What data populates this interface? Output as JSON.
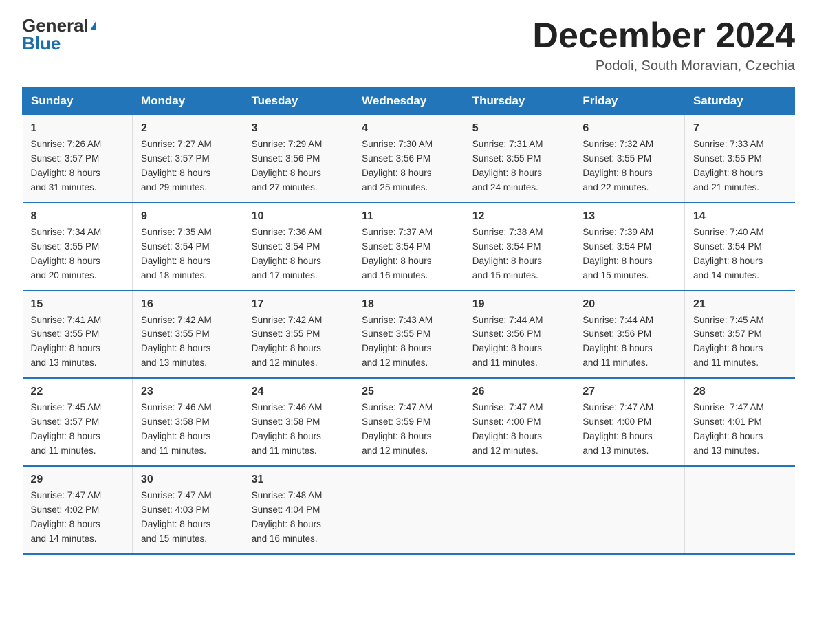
{
  "header": {
    "logo_general": "General",
    "logo_blue": "Blue",
    "title": "December 2024",
    "subtitle": "Podoli, South Moravian, Czechia"
  },
  "days_of_week": [
    "Sunday",
    "Monday",
    "Tuesday",
    "Wednesday",
    "Thursday",
    "Friday",
    "Saturday"
  ],
  "weeks": [
    [
      {
        "day": "1",
        "info": "Sunrise: 7:26 AM\nSunset: 3:57 PM\nDaylight: 8 hours\nand 31 minutes."
      },
      {
        "day": "2",
        "info": "Sunrise: 7:27 AM\nSunset: 3:57 PM\nDaylight: 8 hours\nand 29 minutes."
      },
      {
        "day": "3",
        "info": "Sunrise: 7:29 AM\nSunset: 3:56 PM\nDaylight: 8 hours\nand 27 minutes."
      },
      {
        "day": "4",
        "info": "Sunrise: 7:30 AM\nSunset: 3:56 PM\nDaylight: 8 hours\nand 25 minutes."
      },
      {
        "day": "5",
        "info": "Sunrise: 7:31 AM\nSunset: 3:55 PM\nDaylight: 8 hours\nand 24 minutes."
      },
      {
        "day": "6",
        "info": "Sunrise: 7:32 AM\nSunset: 3:55 PM\nDaylight: 8 hours\nand 22 minutes."
      },
      {
        "day": "7",
        "info": "Sunrise: 7:33 AM\nSunset: 3:55 PM\nDaylight: 8 hours\nand 21 minutes."
      }
    ],
    [
      {
        "day": "8",
        "info": "Sunrise: 7:34 AM\nSunset: 3:55 PM\nDaylight: 8 hours\nand 20 minutes."
      },
      {
        "day": "9",
        "info": "Sunrise: 7:35 AM\nSunset: 3:54 PM\nDaylight: 8 hours\nand 18 minutes."
      },
      {
        "day": "10",
        "info": "Sunrise: 7:36 AM\nSunset: 3:54 PM\nDaylight: 8 hours\nand 17 minutes."
      },
      {
        "day": "11",
        "info": "Sunrise: 7:37 AM\nSunset: 3:54 PM\nDaylight: 8 hours\nand 16 minutes."
      },
      {
        "day": "12",
        "info": "Sunrise: 7:38 AM\nSunset: 3:54 PM\nDaylight: 8 hours\nand 15 minutes."
      },
      {
        "day": "13",
        "info": "Sunrise: 7:39 AM\nSunset: 3:54 PM\nDaylight: 8 hours\nand 15 minutes."
      },
      {
        "day": "14",
        "info": "Sunrise: 7:40 AM\nSunset: 3:54 PM\nDaylight: 8 hours\nand 14 minutes."
      }
    ],
    [
      {
        "day": "15",
        "info": "Sunrise: 7:41 AM\nSunset: 3:55 PM\nDaylight: 8 hours\nand 13 minutes."
      },
      {
        "day": "16",
        "info": "Sunrise: 7:42 AM\nSunset: 3:55 PM\nDaylight: 8 hours\nand 13 minutes."
      },
      {
        "day": "17",
        "info": "Sunrise: 7:42 AM\nSunset: 3:55 PM\nDaylight: 8 hours\nand 12 minutes."
      },
      {
        "day": "18",
        "info": "Sunrise: 7:43 AM\nSunset: 3:55 PM\nDaylight: 8 hours\nand 12 minutes."
      },
      {
        "day": "19",
        "info": "Sunrise: 7:44 AM\nSunset: 3:56 PM\nDaylight: 8 hours\nand 11 minutes."
      },
      {
        "day": "20",
        "info": "Sunrise: 7:44 AM\nSunset: 3:56 PM\nDaylight: 8 hours\nand 11 minutes."
      },
      {
        "day": "21",
        "info": "Sunrise: 7:45 AM\nSunset: 3:57 PM\nDaylight: 8 hours\nand 11 minutes."
      }
    ],
    [
      {
        "day": "22",
        "info": "Sunrise: 7:45 AM\nSunset: 3:57 PM\nDaylight: 8 hours\nand 11 minutes."
      },
      {
        "day": "23",
        "info": "Sunrise: 7:46 AM\nSunset: 3:58 PM\nDaylight: 8 hours\nand 11 minutes."
      },
      {
        "day": "24",
        "info": "Sunrise: 7:46 AM\nSunset: 3:58 PM\nDaylight: 8 hours\nand 11 minutes."
      },
      {
        "day": "25",
        "info": "Sunrise: 7:47 AM\nSunset: 3:59 PM\nDaylight: 8 hours\nand 12 minutes."
      },
      {
        "day": "26",
        "info": "Sunrise: 7:47 AM\nSunset: 4:00 PM\nDaylight: 8 hours\nand 12 minutes."
      },
      {
        "day": "27",
        "info": "Sunrise: 7:47 AM\nSunset: 4:00 PM\nDaylight: 8 hours\nand 13 minutes."
      },
      {
        "day": "28",
        "info": "Sunrise: 7:47 AM\nSunset: 4:01 PM\nDaylight: 8 hours\nand 13 minutes."
      }
    ],
    [
      {
        "day": "29",
        "info": "Sunrise: 7:47 AM\nSunset: 4:02 PM\nDaylight: 8 hours\nand 14 minutes."
      },
      {
        "day": "30",
        "info": "Sunrise: 7:47 AM\nSunset: 4:03 PM\nDaylight: 8 hours\nand 15 minutes."
      },
      {
        "day": "31",
        "info": "Sunrise: 7:48 AM\nSunset: 4:04 PM\nDaylight: 8 hours\nand 16 minutes."
      },
      {
        "day": "",
        "info": ""
      },
      {
        "day": "",
        "info": ""
      },
      {
        "day": "",
        "info": ""
      },
      {
        "day": "",
        "info": ""
      }
    ]
  ]
}
